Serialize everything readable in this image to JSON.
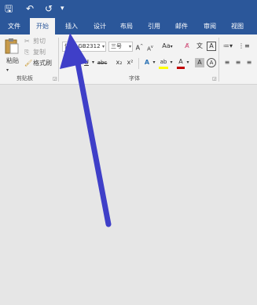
{
  "quick_access": {
    "save_icon": "save-icon",
    "undo_icon": "undo-icon",
    "redo_icon": "redo-icon",
    "customize_icon": "customize-icon"
  },
  "tabs": [
    {
      "label": "文件",
      "active": false
    },
    {
      "label": "开始",
      "active": true
    },
    {
      "label": "插入",
      "active": false
    },
    {
      "label": "设计",
      "active": false
    },
    {
      "label": "布局",
      "active": false
    },
    {
      "label": "引用",
      "active": false
    },
    {
      "label": "邮件",
      "active": false
    },
    {
      "label": "审阅",
      "active": false
    },
    {
      "label": "视图",
      "active": false
    }
  ],
  "clipboard": {
    "paste_label": "粘贴",
    "cut_label": "剪切",
    "copy_label": "复制",
    "format_painter_label": "格式刷",
    "group_label": "剪贴板"
  },
  "font": {
    "font_name": "仿宋_GB2312",
    "font_size": "三号",
    "grow_label": "A",
    "shrink_label": "A",
    "case_label": "Aa",
    "bold": "B",
    "italic": "I",
    "underline": "U",
    "strikethrough": "abc",
    "subscript": "x₂",
    "superscript": "x²",
    "text_effects": "A",
    "highlight": "ab",
    "font_color": "A",
    "char_shading": "A",
    "group_label": "字体"
  },
  "colors": {
    "ribbon_blue": "#2b579a",
    "arrow": "#3f3fc8",
    "highlight_yellow": "#ffff00",
    "font_red": "#c00000"
  }
}
